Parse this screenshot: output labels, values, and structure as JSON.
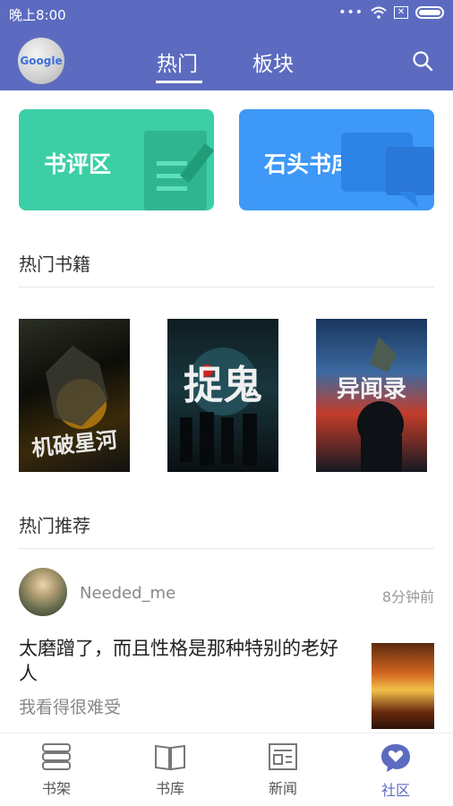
{
  "status_bar": {
    "time": "晚上8:00",
    "icons": [
      "signal-dots-icon",
      "wifi-icon",
      "x-box-icon",
      "battery-icon"
    ]
  },
  "app_bar": {
    "logo_text": "Google",
    "tabs": [
      {
        "label": "热门",
        "active": true
      },
      {
        "label": "板块",
        "active": false
      }
    ],
    "search_icon": "search-icon"
  },
  "cards": [
    {
      "label": "书评区",
      "color": "#3ccfa6",
      "icon": "document-pencil-icon"
    },
    {
      "label": "石头书库",
      "color": "#3d98f7",
      "icon": "chat-bubble-icon"
    }
  ],
  "hot_books": {
    "title": "热门书籍",
    "books": [
      {
        "cover_title": "机破星河"
      },
      {
        "cover_title": "捉鬼"
      },
      {
        "cover_title": "异闻录"
      }
    ]
  },
  "recommend": {
    "title": "热门推荐",
    "post": {
      "user": "Needed_me",
      "time": "8分钟前",
      "title": "太磨蹭了，而且性格是那种特别的老好人",
      "body": "我看得很难受"
    }
  },
  "bottom_nav": [
    {
      "label": "书架",
      "icon": "bookshelf-icon",
      "active": false
    },
    {
      "label": "书库",
      "icon": "open-book-icon",
      "active": false
    },
    {
      "label": "新闻",
      "icon": "newspaper-icon",
      "active": false
    },
    {
      "label": "社区",
      "icon": "heart-chat-icon",
      "active": true
    }
  ],
  "accent_color": "#5c6bc0"
}
